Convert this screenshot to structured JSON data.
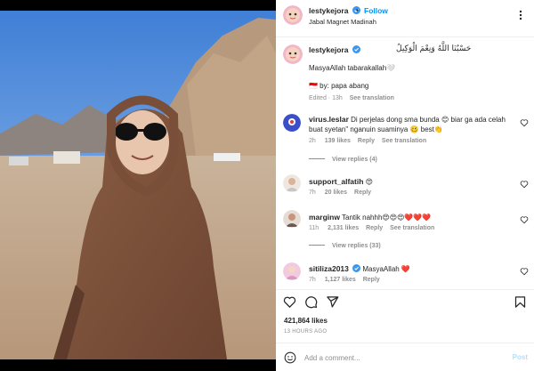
{
  "header": {
    "username": "lestykejora",
    "follow_label": "Follow",
    "location": "Jabal Magnet Madinah"
  },
  "caption": {
    "username": "lestykejora",
    "arabic": "حَسْبُنَا اللَّهُ وَنِعْمَ الْوَكِيلُ",
    "line1": "MasyaAllah tabarakallah🤍",
    "line2": "🇮🇩 by: papa abang",
    "time": "Edited · 13h",
    "translate": "See translation"
  },
  "comments": [
    {
      "username": "virus.leslar",
      "text1": "Di perjelas dong sma bunda 😊 biar ga ada celah",
      "text2": "buat syetan\" nganuin suaminya 🥴 best👏",
      "time": "2h",
      "likes": "139 likes",
      "reply": "Reply",
      "translate": "See translation",
      "view_replies": "View replies (4)"
    },
    {
      "username": "support_alfatih",
      "text1": "😍",
      "time": "7h",
      "likes": "20 likes",
      "reply": "Reply"
    },
    {
      "username": "marginw",
      "text1": "Tantik nahhh😍😍😍❤️❤️❤️",
      "time": "11h",
      "likes": "2,131 likes",
      "reply": "Reply",
      "translate": "See translation",
      "view_replies": "View replies (33)"
    },
    {
      "username": "sitiliza2013",
      "text1": "MasyaAllah ❤️",
      "time": "7h",
      "likes": "1,127 likes",
      "reply": "Reply"
    }
  ],
  "post_stats": {
    "likes": "421,864 likes",
    "ago": "13 HOURS AGO"
  },
  "comment_box": {
    "placeholder": "Add a comment...",
    "post_label": "Post"
  },
  "colors": {
    "link_blue": "#0095f6",
    "verified_blue": "#3897f0",
    "muted": "#8e8e8e"
  }
}
